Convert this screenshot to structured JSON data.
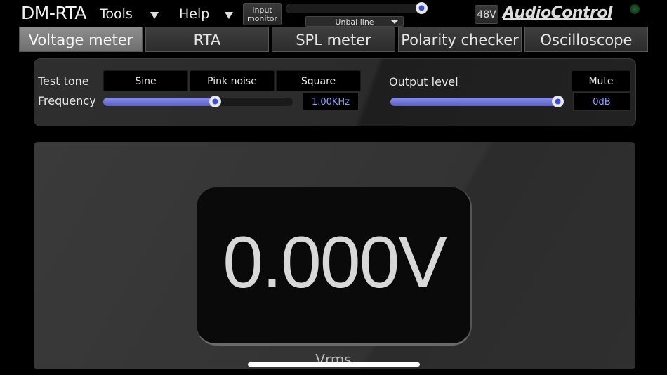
{
  "app": {
    "title": "DM-RTA"
  },
  "menu": {
    "tools": "Tools",
    "help": "Help"
  },
  "toolbar": {
    "input_monitor_line1": "Input",
    "input_monitor_line2": "monitor",
    "input_select": "Unbal line",
    "phantom": "48V",
    "logo": "AudioControl",
    "input_level_fraction": 0.95
  },
  "tabs": [
    {
      "label": "Voltage meter",
      "active": true
    },
    {
      "label": "RTA",
      "active": false
    },
    {
      "label": "SPL meter",
      "active": false
    },
    {
      "label": "Polarity checker",
      "active": false
    },
    {
      "label": "Oscilloscope",
      "active": false
    }
  ],
  "generator": {
    "test_tone_label": "Test tone",
    "tones": [
      "Sine",
      "Pink noise",
      "Square"
    ],
    "frequency_label": "Frequency",
    "frequency_value": "1.00KHz",
    "frequency_fraction": 0.59,
    "output_level_label": "Output level",
    "mute_label": "Mute",
    "output_value": "0dB",
    "output_fraction": 1.0
  },
  "meter": {
    "value": "0.000V",
    "units": "Vrms"
  },
  "colors": {
    "accent": "#5b5fc7",
    "value_text": "#8aa0ff",
    "active_tab": "#7d7d7d"
  }
}
